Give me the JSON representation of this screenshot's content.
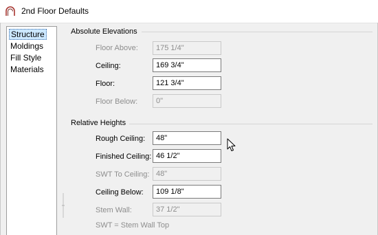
{
  "window": {
    "title": "2nd Floor Defaults",
    "app_icon": "arch-icon"
  },
  "nav": {
    "items": [
      {
        "label": "Structure",
        "selected": true
      },
      {
        "label": "Moldings",
        "selected": false
      },
      {
        "label": "Fill Style",
        "selected": false
      },
      {
        "label": "Materials",
        "selected": false
      }
    ]
  },
  "absolute_elevations": {
    "title": "Absolute Elevations",
    "floor_above": {
      "label": "Floor Above:",
      "value": "175 1/4\"",
      "enabled": false
    },
    "ceiling": {
      "label": "Ceiling:",
      "value": "169 3/4\"",
      "enabled": true
    },
    "floor": {
      "label": "Floor:",
      "value": "121 3/4\"",
      "enabled": true
    },
    "floor_below": {
      "label": "Floor Below:",
      "value": "0\"",
      "enabled": false
    }
  },
  "relative_heights": {
    "title": "Relative Heights",
    "rough_ceiling": {
      "label": "Rough Ceiling:",
      "value": "48\"",
      "enabled": true
    },
    "finished_ceiling": {
      "label": "Finished Ceiling:",
      "value": "46 1/2\"",
      "enabled": true
    },
    "swt_to_ceiling": {
      "label": "SWT To Ceiling:",
      "value": "48\"",
      "enabled": false
    },
    "ceiling_below": {
      "label": "Ceiling Below:",
      "value": "109 1/8\"",
      "enabled": true
    },
    "stem_wall": {
      "label": "Stem Wall:",
      "value": "37 1/2\"",
      "enabled": false
    },
    "note": "SWT = Stem Wall Top"
  },
  "icons": {
    "splitter": "splitter-grip-icon",
    "cursor": "mouse-pointer-icon"
  }
}
